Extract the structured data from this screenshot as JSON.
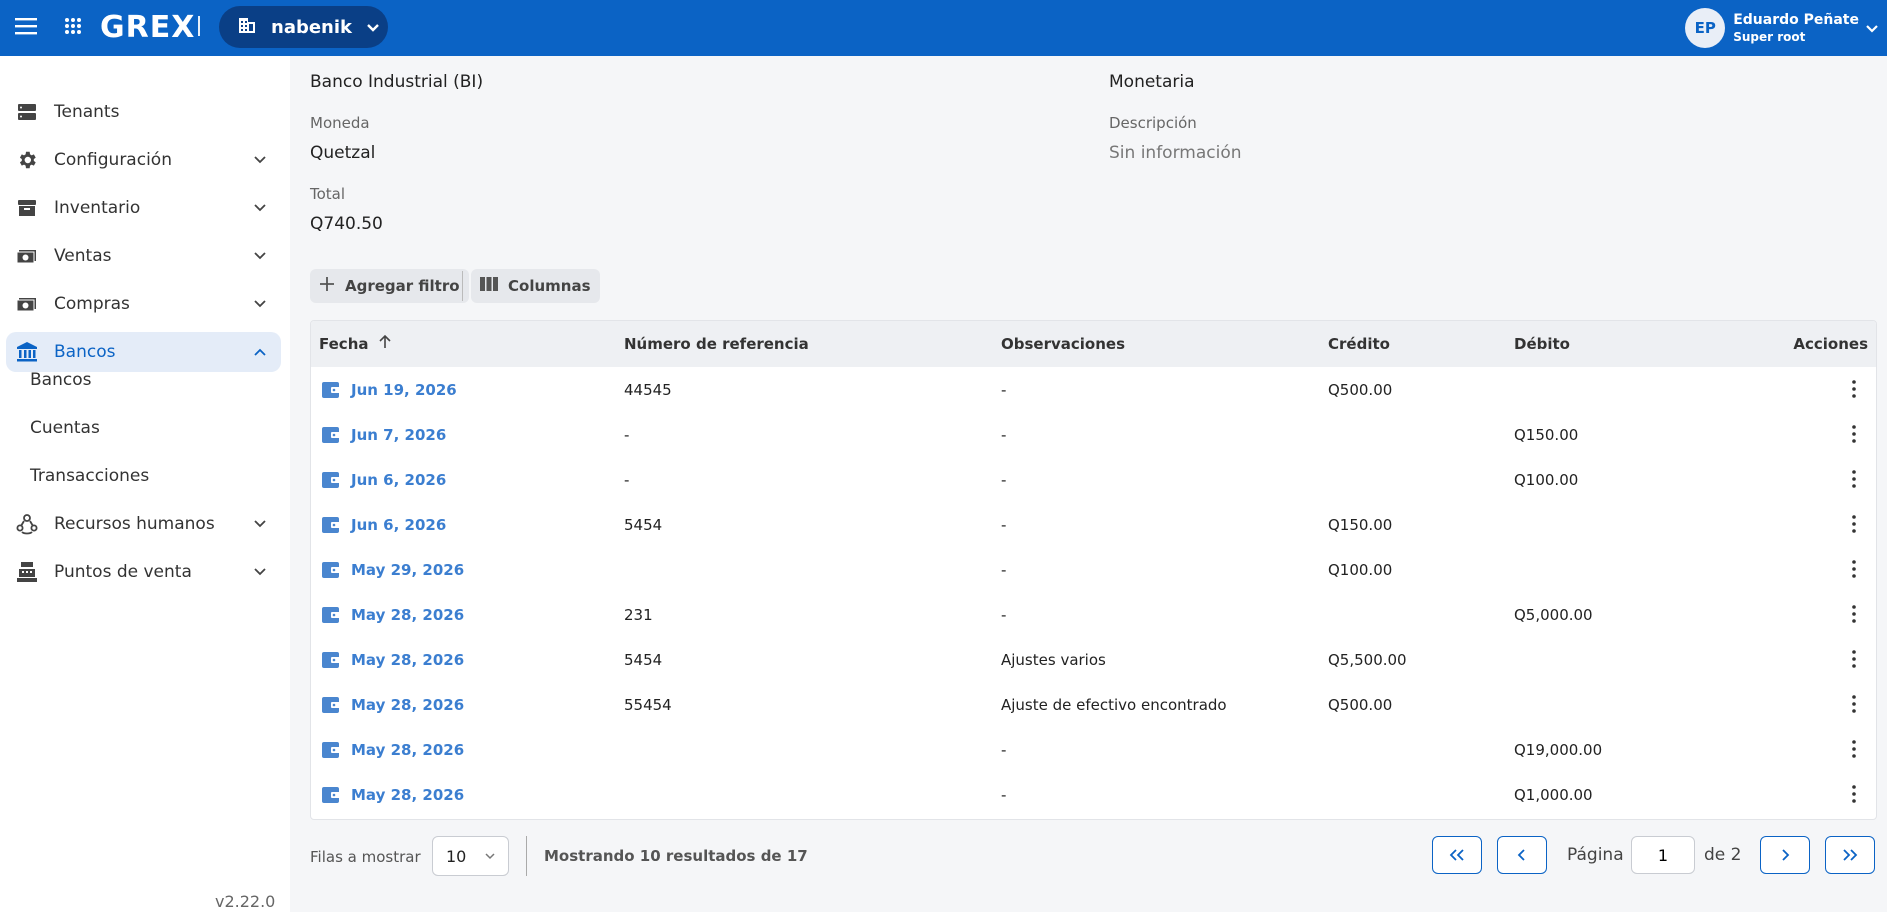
{
  "topbar": {
    "logo": "GREX",
    "tenant": "nabenik",
    "user": {
      "initials": "EP",
      "name": "Eduardo Peñate",
      "role": "Super root"
    }
  },
  "sidebar": {
    "items": [
      {
        "label": "Tenants",
        "icon": "server-icon"
      },
      {
        "label": "Configuración",
        "icon": "gear-icon"
      },
      {
        "label": "Inventario",
        "icon": "archive-icon"
      },
      {
        "label": "Ventas",
        "icon": "money-icon"
      },
      {
        "label": "Compras",
        "icon": "money-icon"
      },
      {
        "label": "Bancos",
        "icon": "bank-icon"
      },
      {
        "label": "Recursos humanos",
        "icon": "people-icon"
      },
      {
        "label": "Puntos de venta",
        "icon": "cash-register-icon"
      }
    ],
    "subitems": [
      "Bancos",
      "Cuentas",
      "Transacciones"
    ],
    "version": "v2.22.0"
  },
  "details": {
    "bank_value": "Banco Industrial (BI)",
    "type_value": "Monetaria",
    "currency_label": "Moneda",
    "currency_value": "Quetzal",
    "description_label": "Descripción",
    "description_value": "Sin información",
    "total_label": "Total",
    "total_value": "Q740.50"
  },
  "toolbar": {
    "add_filter": "Agregar filtro",
    "columns": "Columnas"
  },
  "table": {
    "headers": [
      "Fecha",
      "Número de referencia",
      "Observaciones",
      "Crédito",
      "Débito",
      "Acciones"
    ],
    "rows": [
      {
        "date": "Jun 19, 2026",
        "ref": "44545",
        "obs": "-",
        "credit": "Q500.00",
        "debit": ""
      },
      {
        "date": "Jun 7, 2026",
        "ref": "-",
        "obs": "-",
        "credit": "",
        "debit": "Q150.00"
      },
      {
        "date": "Jun 6, 2026",
        "ref": "-",
        "obs": "-",
        "credit": "",
        "debit": "Q100.00"
      },
      {
        "date": "Jun 6, 2026",
        "ref": "5454",
        "obs": "-",
        "credit": "Q150.00",
        "debit": ""
      },
      {
        "date": "May 29, 2026",
        "ref": "",
        "obs": "-",
        "credit": "Q100.00",
        "debit": ""
      },
      {
        "date": "May 28, 2026",
        "ref": "231",
        "obs": "-",
        "credit": "",
        "debit": "Q5,000.00"
      },
      {
        "date": "May 28, 2026",
        "ref": "5454",
        "obs": "Ajustes varios",
        "credit": "Q5,500.00",
        "debit": ""
      },
      {
        "date": "May 28, 2026",
        "ref": "55454",
        "obs": "Ajuste de efectivo encontrado",
        "credit": "Q500.00",
        "debit": ""
      },
      {
        "date": "May 28, 2026",
        "ref": "",
        "obs": "-",
        "credit": "",
        "debit": "Q19,000.00"
      },
      {
        "date": "May 28, 2026",
        "ref": "",
        "obs": "-",
        "credit": "",
        "debit": "Q1,000.00"
      }
    ]
  },
  "footer": {
    "rows_label": "Filas a mostrar",
    "rows_value": "10",
    "showing": "Mostrando 10 resultados de 17",
    "page_label": "Página",
    "page_value": "1",
    "page_of": "de 2"
  },
  "colors": {
    "primary": "#0b63c5",
    "pill": "#0a3f86",
    "link": "#3b7ed0",
    "active_bg": "#e4ecf8"
  }
}
